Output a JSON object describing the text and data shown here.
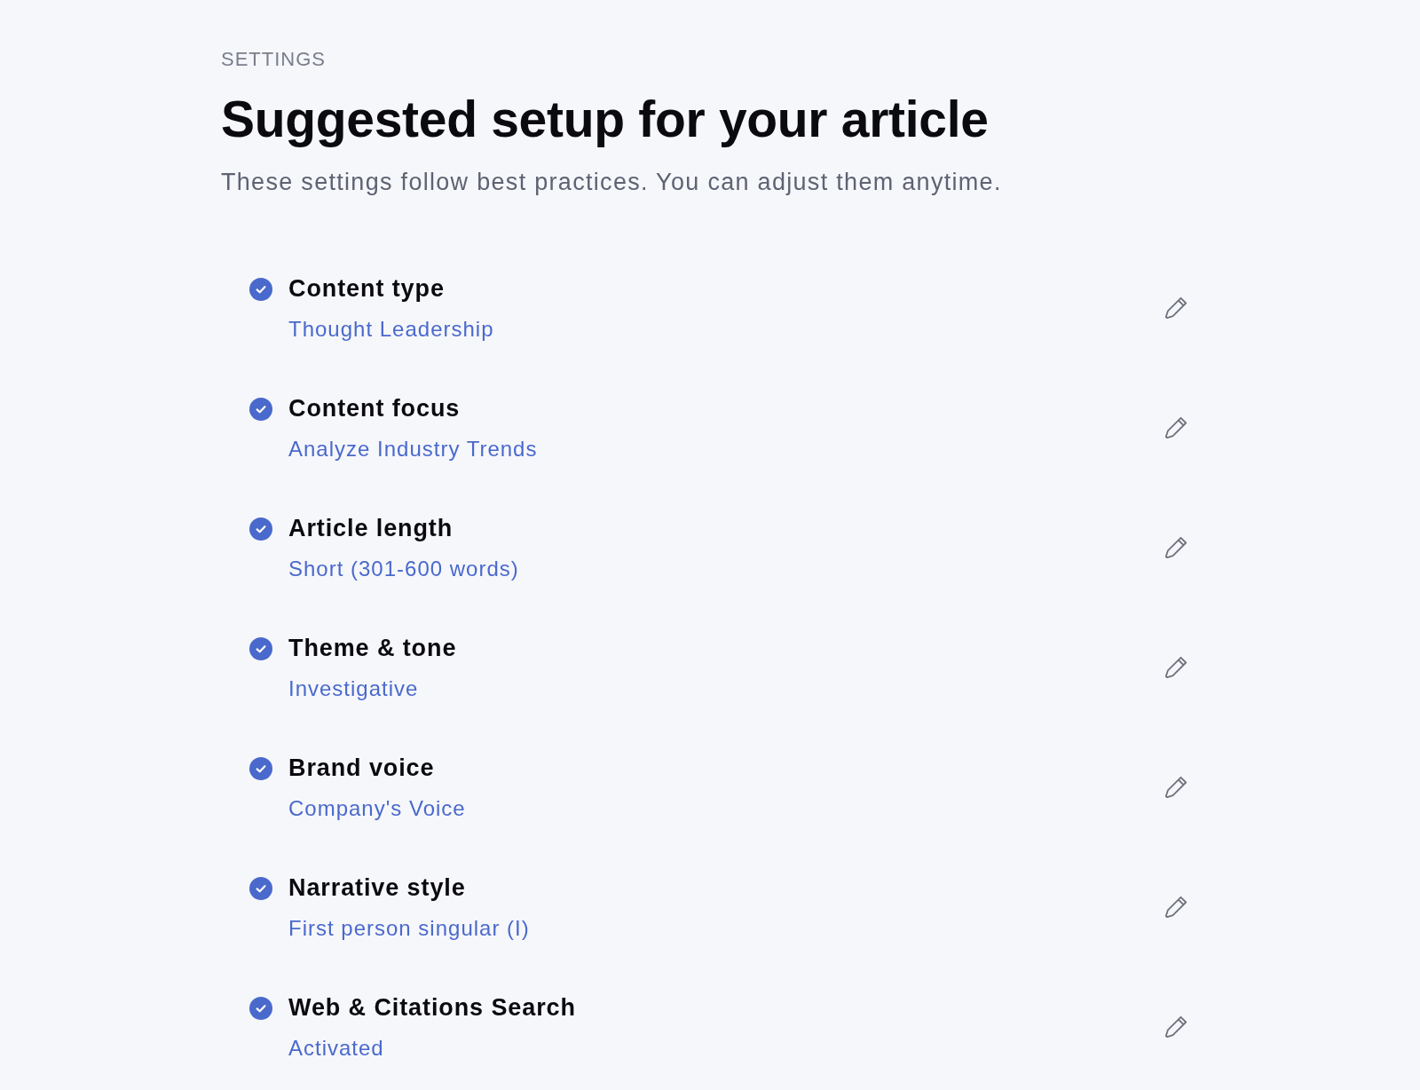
{
  "header": {
    "eyebrow": "SETTINGS",
    "title": "Suggested setup for your article",
    "subtitle": "These settings follow best practices. You can adjust them anytime."
  },
  "settings": [
    {
      "label": "Content type",
      "value": "Thought Leadership",
      "checked": true
    },
    {
      "label": "Content focus",
      "value": "Analyze Industry Trends",
      "checked": true
    },
    {
      "label": "Article length",
      "value": "Short (301-600 words)",
      "checked": true
    },
    {
      "label": "Theme & tone",
      "value": "Investigative",
      "checked": true
    },
    {
      "label": "Brand voice",
      "value": "Company's Voice",
      "checked": true
    },
    {
      "label": "Narrative style",
      "value": "First person singular (I)",
      "checked": true
    },
    {
      "label": "Web & Citations Search",
      "value": "Activated",
      "checked": true
    }
  ]
}
